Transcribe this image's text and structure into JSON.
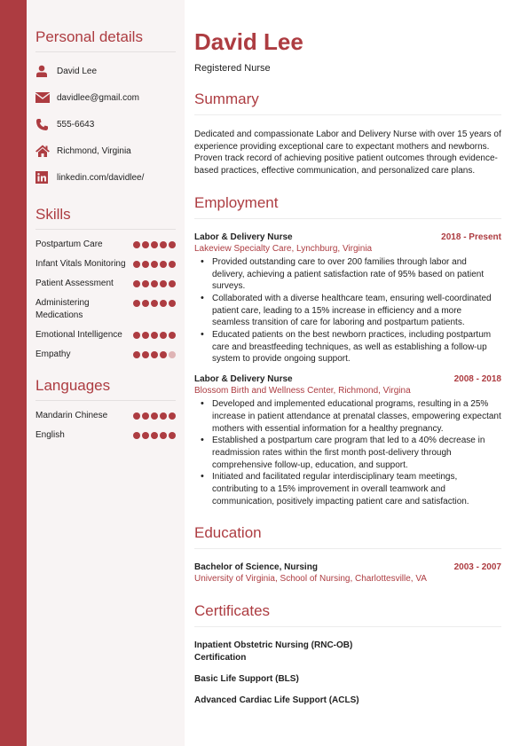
{
  "colors": {
    "accent": "#ad3c41",
    "sidebar_bg": "#f8f4f4",
    "dot_off": "#dfb4b5"
  },
  "sidebar": {
    "personal": {
      "heading": "Personal details",
      "items": [
        {
          "icon": "person-icon",
          "text": "David Lee"
        },
        {
          "icon": "envelope-icon",
          "text": "davidlee@gmail.com"
        },
        {
          "icon": "phone-icon",
          "text": "555-6643"
        },
        {
          "icon": "home-icon",
          "text": "Richmond, Virginia"
        },
        {
          "icon": "linkedin-icon",
          "text": "linkedin.com/davidlee/"
        }
      ]
    },
    "skills": {
      "heading": "Skills",
      "items": [
        {
          "name": "Postpartum Care",
          "level": 5,
          "max": 5
        },
        {
          "name": "Infant Vitals Monitoring",
          "level": 5,
          "max": 5
        },
        {
          "name": "Patient Assessment",
          "level": 5,
          "max": 5
        },
        {
          "name": "Administering Medications",
          "level": 5,
          "max": 5
        },
        {
          "name": "Emotional Intelligence",
          "level": 5,
          "max": 5
        },
        {
          "name": "Empathy",
          "level": 4,
          "max": 5
        }
      ]
    },
    "languages": {
      "heading": "Languages",
      "items": [
        {
          "name": "Mandarin Chinese",
          "level": 5,
          "max": 5
        },
        {
          "name": "English",
          "level": 5,
          "max": 5
        }
      ]
    }
  },
  "main": {
    "name": "David Lee",
    "title": "Registered Nurse",
    "summary": {
      "heading": "Summary",
      "text": "Dedicated and compassionate Labor and Delivery Nurse with over 15 years of experience providing exceptional care to expectant mothers and newborns. Proven track record of achieving positive patient outcomes through evidence-based practices, effective communication, and personalized care plans."
    },
    "employment": {
      "heading": "Employment",
      "jobs": [
        {
          "role": "Labor & Delivery Nurse",
          "dates": "2018 - Present",
          "org": "Lakeview Specialty Care, Lynchburg, Virginia",
          "bullets": [
            "Provided outstanding care to over 200 families through labor and delivery, achieving a patient satisfaction rate of 95% based on patient surveys.",
            "Collaborated with a diverse healthcare team, ensuring well-coordinated patient care, leading to a 15% increase in efficiency and a more seamless transition of care for laboring and postpartum patients.",
            "Educated patients on the best newborn practices, including postpartum care and breastfeeding techniques, as well as establishing a follow-up system to provide ongoing support."
          ]
        },
        {
          "role": "Labor & Delivery Nurse",
          "dates": "2008 - 2018",
          "org": "Blossom Birth and Wellness Center, Richmond, Virgina",
          "bullets": [
            "Developed and implemented educational programs, resulting in a 25% increase in patient attendance at prenatal classes, empowering expectant mothers with essential information for a healthy pregnancy.",
            "Established a postpartum care program that led to a 40% decrease in readmission rates within the first month post-delivery through comprehensive follow-up, education, and support.",
            "Initiated and facilitated regular interdisciplinary team meetings, contributing to a 15% improvement in overall teamwork and communication, positively impacting patient care and satisfaction."
          ]
        }
      ]
    },
    "education": {
      "heading": "Education",
      "items": [
        {
          "degree": "Bachelor of Science, Nursing",
          "dates": "2003 - 2007",
          "school": "University of Virginia, School of Nursing, Charlottesville, VA"
        }
      ]
    },
    "certificates": {
      "heading": "Certificates",
      "items": [
        "Inpatient Obstetric Nursing (RNC-OB) Certification",
        "Basic Life Support (BLS)",
        "Advanced Cardiac Life Support (ACLS)"
      ]
    }
  }
}
